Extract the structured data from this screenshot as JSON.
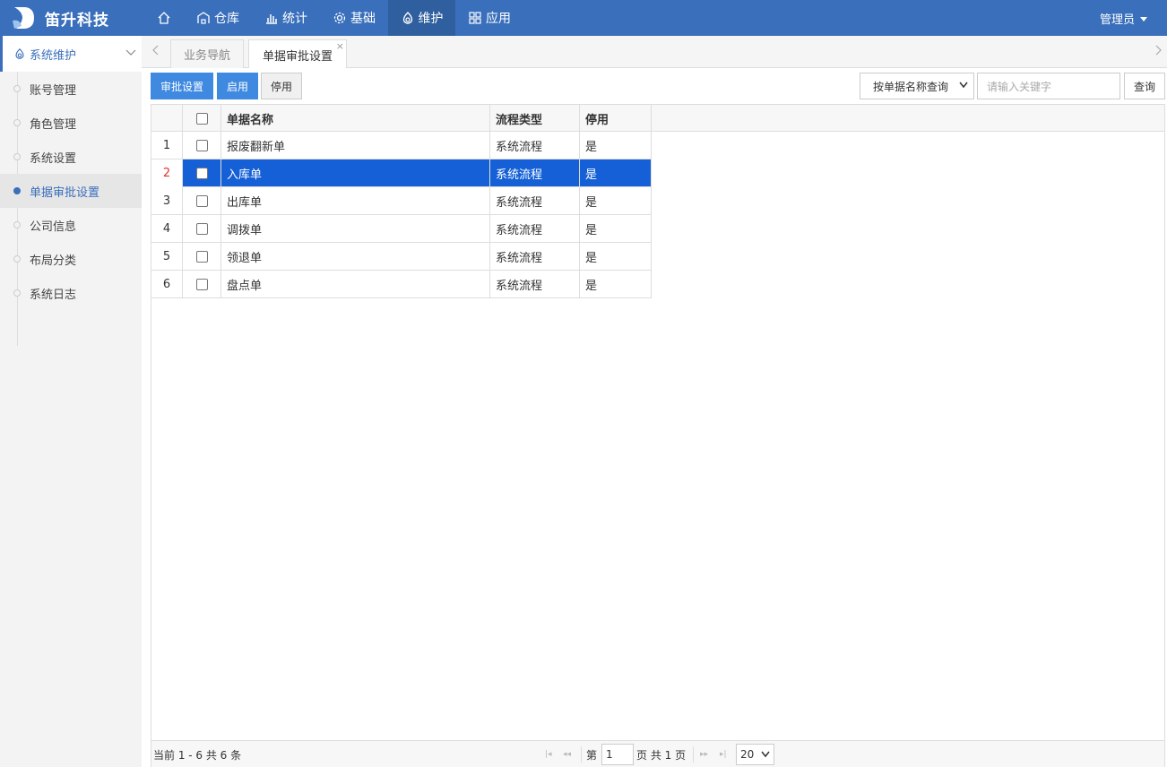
{
  "app": {
    "name": "笛升科技",
    "user": "管理员"
  },
  "nav": [
    {
      "label": "",
      "icon": "home-icon"
    },
    {
      "label": "仓库",
      "icon": "warehouse-icon"
    },
    {
      "label": "统计",
      "icon": "chart-icon"
    },
    {
      "label": "基础",
      "icon": "gear-icon"
    },
    {
      "label": "维护",
      "icon": "maintenance-icon",
      "active": true
    },
    {
      "label": "应用",
      "icon": "apps-icon"
    }
  ],
  "sidebar": {
    "header": "系统维护",
    "items": [
      {
        "label": "账号管理"
      },
      {
        "label": "角色管理"
      },
      {
        "label": "系统设置"
      },
      {
        "label": "单据审批设置",
        "active": true
      },
      {
        "label": "公司信息"
      },
      {
        "label": "布局分类"
      },
      {
        "label": "系统日志"
      }
    ]
  },
  "tabs": [
    {
      "label": "业务导航"
    },
    {
      "label": "单据审批设置",
      "active": true,
      "close": "×"
    }
  ],
  "toolbar": {
    "approve_settings": "审批设置",
    "enable": "启用",
    "disable": "停用",
    "search_mode": "按单据名称查询",
    "search_placeholder": "请输入关键字",
    "search": "查询"
  },
  "table": {
    "columns": [
      "单据名称",
      "流程类型",
      "停用"
    ],
    "rows": [
      {
        "num": "1",
        "name": "报废翻新单",
        "type": "系统流程",
        "disabled": "是"
      },
      {
        "num": "2",
        "name": "入库单",
        "type": "系统流程",
        "disabled": "是",
        "selected": true
      },
      {
        "num": "3",
        "name": "出库单",
        "type": "系统流程",
        "disabled": "是"
      },
      {
        "num": "4",
        "name": "调拨单",
        "type": "系统流程",
        "disabled": "是"
      },
      {
        "num": "5",
        "name": "领退单",
        "type": "系统流程",
        "disabled": "是"
      },
      {
        "num": "6",
        "name": "盘点单",
        "type": "系统流程",
        "disabled": "是"
      }
    ]
  },
  "pagination": {
    "summary": "当前 1 - 6 共 6 条",
    "page_prefix": "第",
    "page": "1",
    "page_suffix": "页 共 1 页",
    "page_size": "20"
  },
  "colors": {
    "topbar": "#3a6fbb",
    "selected_row": "#1560d6",
    "primary_button": "#3f8ae0"
  }
}
